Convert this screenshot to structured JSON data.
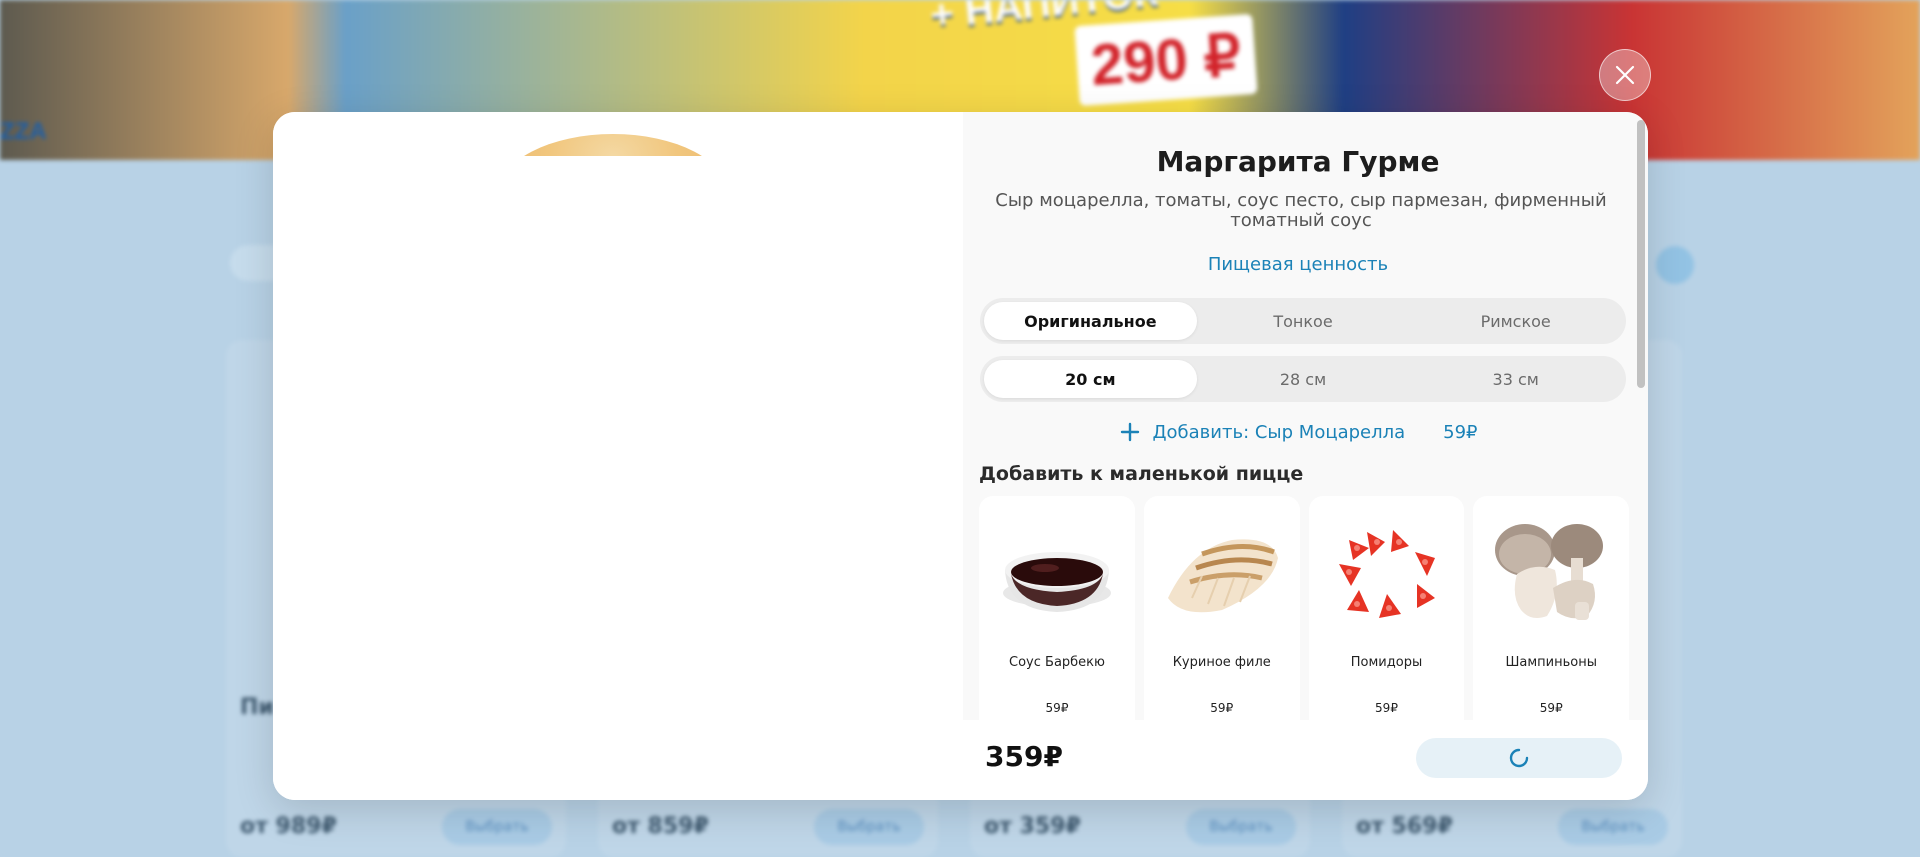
{
  "background": {
    "promo_text": "+ НАПИТОК",
    "promo_price": "290 ₽",
    "logo_text": "ZZA",
    "cards": [
      {
        "title": "Пи",
        "from_price": "от 989₽",
        "button": "Выбрать"
      },
      {
        "title": "",
        "from_price": "от 859₽",
        "button": "Выбрать"
      },
      {
        "title": "",
        "from_price": "от 359₽",
        "button": "Выбрать"
      },
      {
        "title": "",
        "from_price": "от 569₽",
        "button": "Выбрать"
      }
    ]
  },
  "modal": {
    "close_icon": "close-icon",
    "product": {
      "title": "Маргарита Гурме",
      "description": "Сыр моцарелла, томаты, соус песто, сыр пармезан, фирменный томатный соус",
      "nutrition_link": "Пищевая ценность"
    },
    "dough_options": {
      "selected": "Оригинальное",
      "items": [
        "Оригинальное",
        "Тонкое",
        "Римское"
      ]
    },
    "size_options": {
      "selected": "20 см",
      "items": [
        "20 см",
        "28 см",
        "33 см"
      ]
    },
    "extra_cheese": {
      "icon": "plus-icon",
      "label": "Добавить: Сыр Моцарелла",
      "price": "59₽"
    },
    "toppings": {
      "heading": "Добавить к маленькой пицце",
      "items": [
        {
          "name": "Соус Барбекю",
          "price": "59₽",
          "icon": "bbq-sauce-image"
        },
        {
          "name": "Куриное филе",
          "price": "59₽",
          "icon": "chicken-image"
        },
        {
          "name": "Помидоры",
          "price": "59₽",
          "icon": "tomato-image"
        },
        {
          "name": "Шампиньоны",
          "price": "59₽",
          "icon": "mushroom-image"
        }
      ]
    },
    "footer": {
      "total": "359₽",
      "button_state": "loading",
      "spinner_icon": "spinner-icon"
    }
  },
  "colors": {
    "accent": "#1b82b7",
    "overlay": "#b9d3e6",
    "panel": "#f9f9f9"
  }
}
